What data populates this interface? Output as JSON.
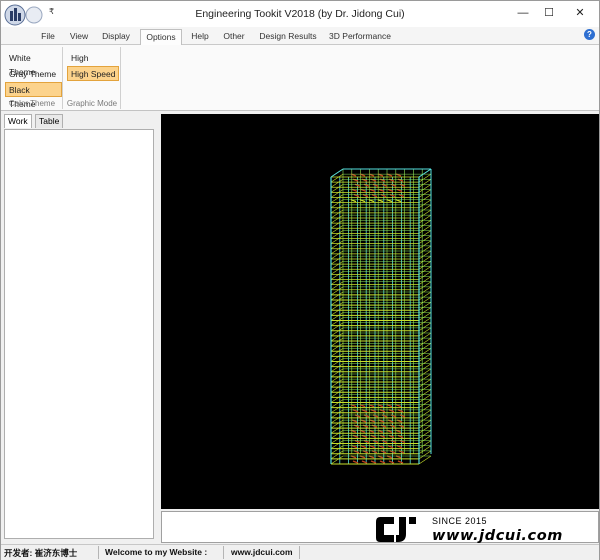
{
  "window": {
    "title": "Engineering Tookit V2018 (by Dr. Jidong Cui)",
    "quick_access": "₹",
    "controls": {
      "minimize": "—",
      "maximize": "☐",
      "close": "✕"
    }
  },
  "menu": {
    "tabs": [
      "File",
      "View",
      "Display",
      "Options",
      "Help",
      "Other",
      "Design Results",
      "3D Performance"
    ],
    "selected": "Options",
    "help_icon": "?"
  },
  "ribbon": {
    "color_theme": {
      "caption": "Color Theme",
      "buttons": [
        "White Theme",
        "Gray Theme",
        "Black Theme"
      ],
      "active": "Black Theme"
    },
    "graphic_mode": {
      "caption": "Graphic Mode",
      "buttons": [
        "High Quality",
        "High Speed"
      ],
      "active": "High Speed"
    }
  },
  "left_panel": {
    "tabs": [
      "Work",
      "Table"
    ],
    "selected": "Work"
  },
  "viewport": {
    "background": "#000000",
    "model_colors": {
      "frame": "#55e0e0",
      "floor": "#c8e02a",
      "hot": "#c0401c",
      "accent": "#8ee65a"
    }
  },
  "watermark": {
    "since": "SINCE 2015",
    "url": "www.jdcui.com"
  },
  "statusbar": {
    "developer": "开发者: 崔济东博士",
    "welcome": "Welcome to my Website :",
    "website": "www.jdcui.com"
  },
  "icons": [
    "app-logo-icon",
    "help-icon",
    "minimize-icon",
    "maximize-icon",
    "close-icon",
    "watermark-logo-icon"
  ]
}
